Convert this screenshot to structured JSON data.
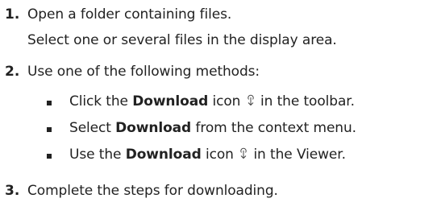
{
  "steps": [
    {
      "number": "1.",
      "lines": [
        "Open a folder containing files.",
        "Select one or several files in the display area."
      ]
    },
    {
      "number": "2.",
      "text": "Use one of the following methods:"
    },
    {
      "number": "3.",
      "text": "Complete the steps for downloading."
    }
  ],
  "methods": [
    {
      "pre": "Click the",
      "bold": "Download",
      "mid": "icon",
      "icon": "download-icon",
      "post": "in the toolbar."
    },
    {
      "pre": "Select",
      "bold": "Download",
      "post": "from the context menu."
    },
    {
      "pre": "Use the",
      "bold": "Download",
      "mid": "icon",
      "icon": "download-icon",
      "post": "in the Viewer."
    }
  ]
}
